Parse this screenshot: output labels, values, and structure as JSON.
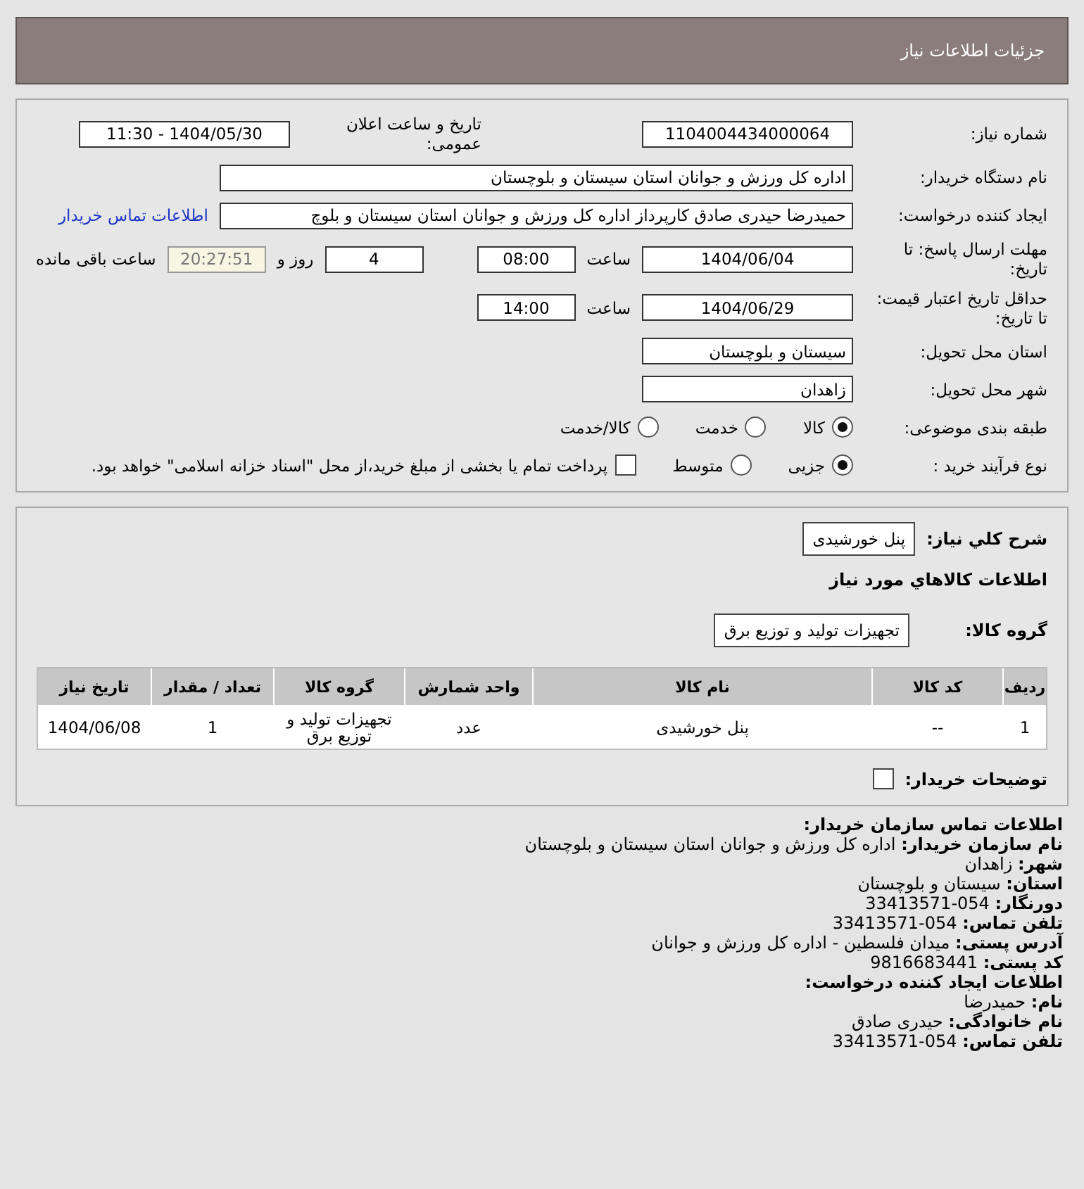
{
  "header": {
    "title": "جزئیات اطلاعات نیاز"
  },
  "need_number": {
    "label": "شماره نیاز:",
    "value": "1104004434000064"
  },
  "announce": {
    "label": "تاریخ و ساعت اعلان عمومی:",
    "value": "1404/05/30 - 11:30"
  },
  "buyer": {
    "label": "نام دستگاه خریدار:",
    "value": "اداره کل ورزش و جوانان استان سیستان و بلوچستان"
  },
  "requester": {
    "label": "ایجاد کننده درخواست:",
    "value": "حمیدرضا حیدری صادق کارپرداز اداره کل ورزش و جوانان استان سیستان و بلوچ",
    "link": "اطلاعات تماس خریدار"
  },
  "deadline": {
    "label": "مهلت ارسال پاسخ: تا تاریخ:",
    "date": "1404/06/04",
    "time_label": "ساعت",
    "time": "08:00",
    "days": "4",
    "days_label": "روز و",
    "remaining": "20:27:51",
    "remaining_label": "ساعت باقی مانده"
  },
  "validity": {
    "label": "حداقل تاریخ اعتبار قیمت: تا تاریخ:",
    "date": "1404/06/29",
    "time_label": "ساعت",
    "time": "14:00"
  },
  "province": {
    "label": "استان محل تحویل:",
    "value": "سیستان و بلوچستان"
  },
  "city": {
    "label": "شهر محل تحویل:",
    "value": "زاهدان"
  },
  "category": {
    "label": "طبقه بندی موضوعی:",
    "options": [
      {
        "label": "کالا",
        "selected": true
      },
      {
        "label": "خدمت",
        "selected": false
      },
      {
        "label": "کالا/خدمت",
        "selected": false
      }
    ]
  },
  "process": {
    "label": "نوع فرآیند خرید :",
    "options": [
      {
        "label": "جزیی",
        "selected": true
      },
      {
        "label": "متوسط",
        "selected": false
      }
    ],
    "payment": {
      "label": "پرداخت تمام یا بخشی از مبلغ خرید،از محل \"اسناد خزانه اسلامی\" خواهد بود.",
      "checked": false
    }
  },
  "description": {
    "label": "شرح کلي نياز:",
    "value": "پنل خورشیدی"
  },
  "goods_heading": "اطلاعات کالاهاي مورد نياز",
  "goods_group": {
    "label": "گروه کالا:",
    "value": "تجهیزات تولید و توزیع برق"
  },
  "table": {
    "columns": [
      "ردیف",
      "کد کالا",
      "نام کالا",
      "واحد شمارش",
      "گروه کالا",
      "تعداد / مقدار",
      "تاریخ نیاز"
    ],
    "rows": [
      [
        "1",
        "--",
        "پنل خورشیدی",
        "عدد",
        "تجهیزات تولید و توزیع برق",
        "1",
        "1404/06/08"
      ]
    ]
  },
  "buyer_notes": {
    "label": "توضیحات خریدار:",
    "checked": false
  },
  "contact": [
    {
      "kind": "heading",
      "text": "اطلاعات تماس سازمان خریدار:"
    },
    {
      "kind": "field",
      "label": "نام سازمان خریدار:",
      "value": "اداره کل ورزش و جوانان استان سیستان و بلوچستان"
    },
    {
      "kind": "field",
      "label": "شهر:",
      "value": "زاهدان"
    },
    {
      "kind": "field",
      "label": "استان:",
      "value": "سیستان و بلوچستان"
    },
    {
      "kind": "field",
      "label": "دورنگار:",
      "value": "054-33413571"
    },
    {
      "kind": "field",
      "label": "تلفن تماس:",
      "value": "054-33413571"
    },
    {
      "kind": "field",
      "label": "آدرس پستی:",
      "value": "میدان فلسطین - اداره کل ورزش و جوانان"
    },
    {
      "kind": "field",
      "label": "کد پستی:",
      "value": "9816683441"
    },
    {
      "kind": "heading",
      "text": "اطلاعات ایجاد کننده درخواست:"
    },
    {
      "kind": "field",
      "label": "نام:",
      "value": "حمیدرضا"
    },
    {
      "kind": "field",
      "label": "نام خانوادگی:",
      "value": "حیدری صادق"
    },
    {
      "kind": "field",
      "label": "تلفن تماس:",
      "value": "054-33413571"
    }
  ]
}
